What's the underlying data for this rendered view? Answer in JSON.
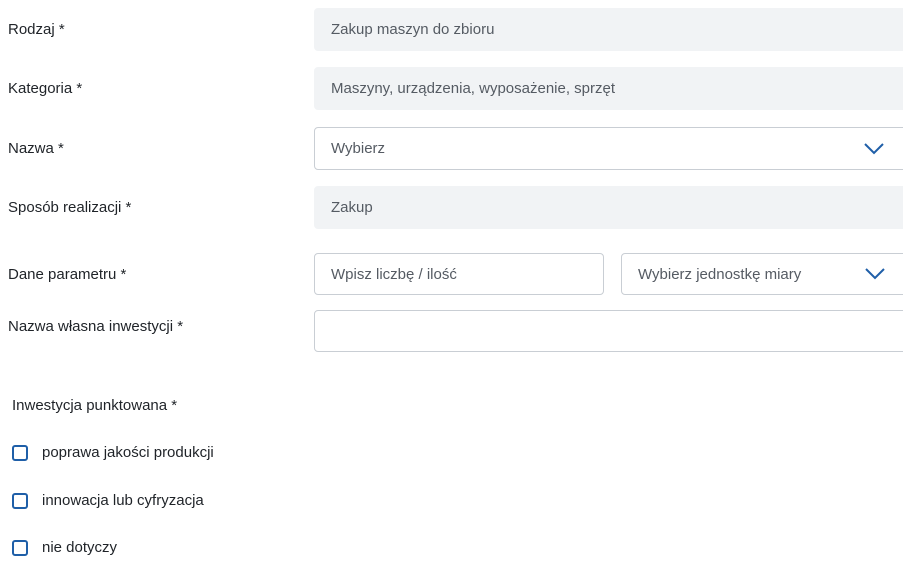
{
  "form": {
    "rodzaj": {
      "label": "Rodzaj *",
      "value": "Zakup maszyn do zbioru"
    },
    "kategoria": {
      "label": "Kategoria *",
      "value": "Maszyny, urządzenia, wyposażenie, sprzęt"
    },
    "nazwa": {
      "label": "Nazwa *",
      "placeholder": "Wybierz",
      "chevron_icon": "chevron-down-icon"
    },
    "sposob_realizacji": {
      "label": "Sposób realizacji *",
      "value": "Zakup"
    },
    "dane_parametru": {
      "label": "Dane parametru *",
      "number_placeholder": "Wpisz liczbę / ilość",
      "unit_placeholder": "Wybierz jednostkę miary",
      "chevron_icon": "chevron-down-icon"
    },
    "nazwa_wlasna": {
      "label": "Nazwa własna inwestycji  *",
      "value": ""
    },
    "inwestycja_punktowana": {
      "title": "Inwestycja punktowana *",
      "options": [
        {
          "label": "poprawa jakości produkcji",
          "checked": false
        },
        {
          "label": "innowacja lub cyfryzacja",
          "checked": false
        },
        {
          "label": "nie dotyczy",
          "checked": false
        }
      ]
    }
  },
  "colors": {
    "accent": "#1f5fa8",
    "readonly_bg": "#f1f3f5",
    "border": "#c9ced4"
  }
}
